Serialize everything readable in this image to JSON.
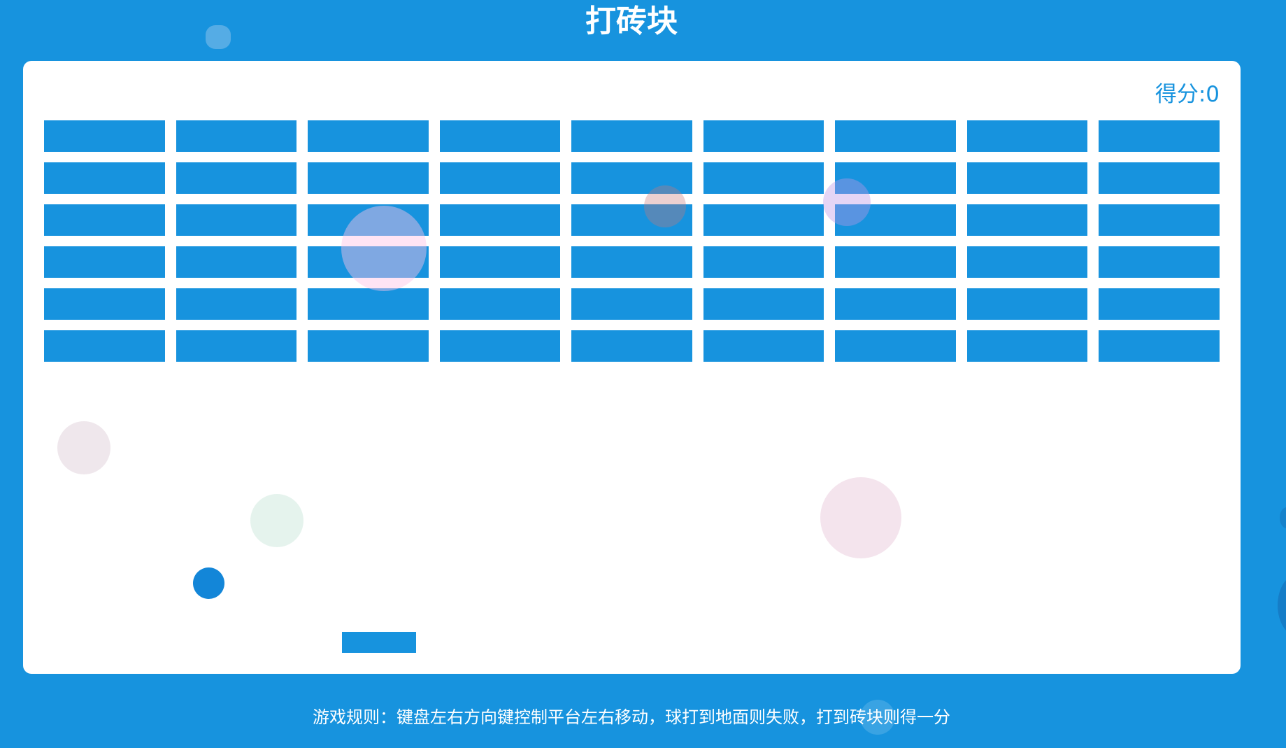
{
  "page": {
    "title": "打砖块",
    "rules": "游戏规则：键盘左右方向键控制平台左右移动，球打到地面则失败，打到砖块则得一分"
  },
  "game": {
    "score_text": "得分:0",
    "bricks": {
      "rows": 6,
      "columns": 9,
      "remaining": 54
    }
  },
  "colors": {
    "background": "#1793de",
    "board": "#ffffff",
    "brick": "#1793de",
    "ball": "#1386d8",
    "paddle": "#1793de",
    "text": "#ffffff"
  }
}
